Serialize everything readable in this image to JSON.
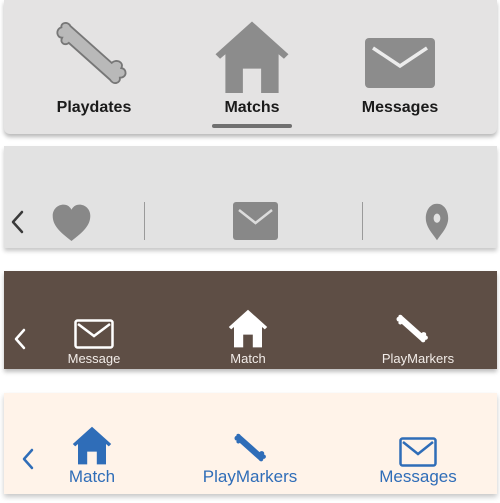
{
  "bar1": {
    "items": [
      {
        "label": "Playdates",
        "icon": "bone-icon"
      },
      {
        "label": "Matchs",
        "icon": "doghouse-icon"
      },
      {
        "label": "Messages",
        "icon": "envelope-icon"
      }
    ],
    "selected": "Matchs",
    "colors": {
      "background": "#e4e3e3",
      "icon": "#8c8c8c",
      "text": "#1b1b1b"
    }
  },
  "bar2": {
    "back_icon": "chevron-left-icon",
    "items": [
      {
        "icon": "heart-icon"
      },
      {
        "icon": "envelope-icon"
      },
      {
        "icon": "map-pin-icon"
      }
    ],
    "colors": {
      "background": "#e2e2e2",
      "icon": "#888888"
    }
  },
  "bar3": {
    "back_icon": "chevron-left-icon",
    "items": [
      {
        "label": "Message",
        "icon": "envelope-icon"
      },
      {
        "label": "Match",
        "icon": "doghouse-icon"
      },
      {
        "label": "PlayMarkers",
        "icon": "bone-icon"
      }
    ],
    "colors": {
      "background": "#5e4e45",
      "icon": "#ffffff",
      "text": "#f2ece8"
    }
  },
  "bar4": {
    "back_icon": "chevron-left-icon",
    "items": [
      {
        "label": "Match",
        "icon": "doghouse-icon"
      },
      {
        "label": "PlayMarkers",
        "icon": "bone-icon"
      },
      {
        "label": "Messages",
        "icon": "envelope-icon"
      }
    ],
    "colors": {
      "background": "#fff3e9",
      "icon": "#2f6db8",
      "text": "#2f6db8"
    }
  }
}
